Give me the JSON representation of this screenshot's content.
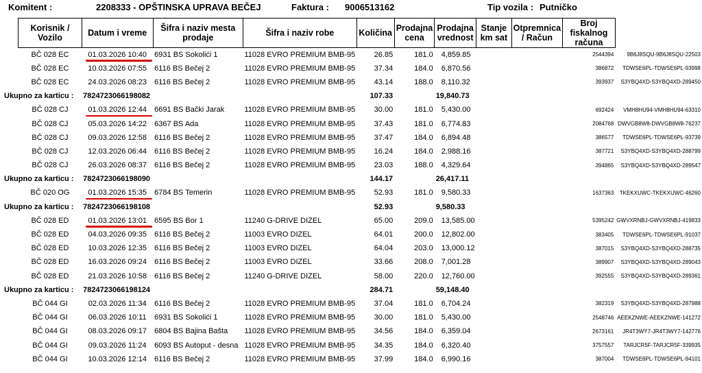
{
  "header": {
    "komitent_label": "Komitent :",
    "komitent_value": "2208333 - OPŠTINSKA UPRAVA BEČEJ",
    "faktura_label": "Faktura :",
    "faktura_value": "9006513162",
    "tip_label": "Tip vozila :",
    "tip_value": "Putničko"
  },
  "columns": [
    "Korisnik / Vozilo",
    "Datum i vreme",
    "Šifra i naziv mesta prodaje",
    "Šifra i naziv robe",
    "Količina",
    "Prodajna cena",
    "Prodajna vrednost",
    "Stanje km sat",
    "Otpremnica / Račun",
    "Broj fiskalnog računa"
  ],
  "total_label": "Ukupno za karticu :",
  "rows": [
    {
      "type": "d",
      "v": "BČ 028 EC",
      "dt": "01.03.2026 10:40",
      "m": "6931 BS Sokolići 1",
      "r": "11028 EVRO PREMIUM BMB-95",
      "q": "26.85",
      "p": "181.0",
      "val": "4,859.85",
      "o": "2544394",
      "f": "9B6J8SQU-9B6J8SQU-22503",
      "mark": true
    },
    {
      "type": "d",
      "v": "BČ 028 EC",
      "dt": "10.03.2026 07:55",
      "m": "6116 BS Bečej 2",
      "r": "11028 EVRO PREMIUM BMB-95",
      "q": "37.34",
      "p": "184.0",
      "val": "6,870.56",
      "o": "386872",
      "f": "TDWSE6PL-TDWSE6PL-93998"
    },
    {
      "type": "d",
      "v": "BČ 028 EC",
      "dt": "24.03.2026 08:23",
      "m": "6116 BS Bečej 2",
      "r": "11028 EVRO PREMIUM BMB-95",
      "q": "43.14",
      "p": "188.0",
      "val": "8,110.32",
      "o": "393937",
      "f": "S3YBQ4XD-S3YBQ4XD-289450"
    },
    {
      "type": "t",
      "card": "7824723066198082",
      "q": "107.33",
      "val": "19,840.73"
    },
    {
      "type": "d",
      "v": "BČ 028 CJ",
      "dt": "01.03.2026 12:44",
      "m": "6691 BS Bački Jarak",
      "r": "11028 EVRO PREMIUM BMB-95",
      "q": "30.00",
      "p": "181.0",
      "val": "5,430.00",
      "o": "692424",
      "f": "VMH8HU94-VMH8HU94-63310",
      "mark": true
    },
    {
      "type": "d",
      "v": "BČ 028 CJ",
      "dt": "05.03.2026 14:22",
      "m": "6367 BS Ada",
      "r": "11028 EVRO PREMIUM BMB-95",
      "q": "37.43",
      "p": "181.0",
      "val": "6,774.83",
      "o": "2084768",
      "f": "DWVGB8W8-DWVGB8W8-76237"
    },
    {
      "type": "d",
      "v": "BČ 028 CJ",
      "dt": "09.03.2026 12:58",
      "m": "6116 BS Bečej 2",
      "r": "11028 EVRO PREMIUM BMB-95",
      "q": "37.47",
      "p": "184.0",
      "val": "6,894.48",
      "o": "386577",
      "f": "TDWSE6PL-TDWSE6PL-93739"
    },
    {
      "type": "d",
      "v": "BČ 028 CJ",
      "dt": "12.03.2026 06:44",
      "m": "6116 BS Bečej 2",
      "r": "11028 EVRO PREMIUM BMB-95",
      "q": "16.24",
      "p": "184.0",
      "val": "2,988.16",
      "o": "387721",
      "f": "S3YBQ4XD-S3YBQ4XD-288799"
    },
    {
      "type": "d",
      "v": "BČ 028 CJ",
      "dt": "26.03.2026 08:37",
      "m": "6116 BS Bečej 2",
      "r": "11028 EVRO PREMIUM BMB-95",
      "q": "23.03",
      "p": "188.0",
      "val": "4,329.64",
      "o": "394865",
      "f": "S3YBQ4XD-S3YBQ4XD-289547"
    },
    {
      "type": "t",
      "card": "7824723066198090",
      "q": "144.17",
      "val": "26,417.11"
    },
    {
      "type": "d",
      "v": "BČ 020 OG",
      "dt": "01.03.2026 15:35",
      "m": "6784 BS Temerin",
      "r": "11028 EVRO PREMIUM BMB-95",
      "q": "52.93",
      "p": "181.0",
      "val": "9,580.33",
      "o": "1637363",
      "f": "TKEKXUWC-TKEKXUWC-46260",
      "mark": true
    },
    {
      "type": "t",
      "card": "7824723066198108",
      "q": "52.93",
      "val": "9,580.33"
    },
    {
      "type": "d",
      "v": "BČ 028 ED",
      "dt": "01.03.2026 13:01",
      "m": "6595 BS Bor 1",
      "r": "11240 G-DRIVE DIZEL",
      "q": "65.00",
      "p": "209.0",
      "val": "13,585.00",
      "o": "5395242",
      "f": "GWVXRNBJ-GWVXRNBJ-419833",
      "mark": true
    },
    {
      "type": "d",
      "v": "BČ 028 ED",
      "dt": "04.03.2026 09:35",
      "m": "6116 BS Bečej 2",
      "r": "11003 EVRO DIZEL",
      "q": "64.01",
      "p": "200.0",
      "val": "12,802.00",
      "o": "383405",
      "f": "TDWSE6PL-TDWSE6PL-91037"
    },
    {
      "type": "d",
      "v": "BČ 028 ED",
      "dt": "10.03.2026 12:35",
      "m": "6116 BS Bečej 2",
      "r": "11003 EVRO DIZEL",
      "q": "64.04",
      "p": "203.0",
      "val": "13,000.12",
      "o": "387015",
      "f": "S3YBQ4XD-S3YBQ4XD-288735"
    },
    {
      "type": "d",
      "v": "BČ 028 ED",
      "dt": "16.03.2026 09:24",
      "m": "6116 BS Bečej 2",
      "r": "11003 EVRO DIZEL",
      "q": "33.66",
      "p": "208.0",
      "val": "7,001.28",
      "o": "389907",
      "f": "S3YBQ4XD-S3YBQ4XD-289043"
    },
    {
      "type": "d",
      "v": "BČ 028 ED",
      "dt": "21.03.2026 10:58",
      "m": "6116 BS Bečej 2",
      "r": "11240 G-DRIVE DIZEL",
      "q": "58.00",
      "p": "220.0",
      "val": "12,760.00",
      "o": "392555",
      "f": "S3YBQ4XD-S3YBQ4XD-289361"
    },
    {
      "type": "t",
      "card": "7824723066198124",
      "q": "284.71",
      "val": "59,148.40"
    },
    {
      "type": "d",
      "v": "BČ 044 GI",
      "dt": "02.03.2026 11:34",
      "m": "6116 BS Bečej 2",
      "r": "11028 EVRO PREMIUM BMB-95",
      "q": "37.04",
      "p": "181.0",
      "val": "6,704.24",
      "o": "382319",
      "f": "S3YBQ4XD-S3YBQ4XD-287988"
    },
    {
      "type": "d",
      "v": "BČ 044 GI",
      "dt": "06.03.2026 10:11",
      "m": "6931 BS Sokolići 1",
      "r": "11028 EVRO PREMIUM BMB-95",
      "q": "30.00",
      "p": "181.0",
      "val": "5,430.00",
      "o": "2548746",
      "f": "AEEKZNWE-AEEKZNWE-141272"
    },
    {
      "type": "d",
      "v": "BČ 044 GI",
      "dt": "08.03.2026 09:17",
      "m": "6804 BS Bajina Bašta",
      "r": "11028 EVRO PREMIUM BMB-95",
      "q": "34.56",
      "p": "184.0",
      "val": "6,359.04",
      "o": "2673161",
      "f": "JR4T3WY7-JR4T3WY7-142776"
    },
    {
      "type": "d",
      "v": "BČ 044 GI",
      "dt": "09.03.2026 11:24",
      "m": "6093 BS Autoput - desna",
      "r": "11028 EVRO PREMIUM BMB-95",
      "q": "34.35",
      "p": "184.0",
      "val": "6,320.40",
      "o": "3757557",
      "f": "TARJCR5F-TARJCR5F-339935"
    },
    {
      "type": "d",
      "v": "BČ 044 GI",
      "dt": "10.03.2026 12:14",
      "m": "6116 BS Bečej 2",
      "r": "11028 EVRO PREMIUM BMB-95",
      "q": "37.99",
      "p": "184.0",
      "val": "6,990.16",
      "o": "387004",
      "f": "TDWSE6PL-TDWSE6PL-94101"
    }
  ]
}
